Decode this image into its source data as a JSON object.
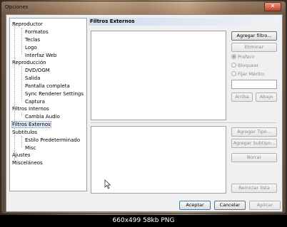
{
  "window": {
    "title": "Opciones",
    "close_glyph": "✕"
  },
  "tree": [
    {
      "label": "Reproductor"
    },
    {
      "label": "Formatos"
    },
    {
      "label": "Teclas"
    },
    {
      "label": "Logo"
    },
    {
      "label": "Interfaz Web"
    },
    {
      "label": "Reproducción"
    },
    {
      "label": "DVD/OGM"
    },
    {
      "label": "Salida"
    },
    {
      "label": "Pantalla completa"
    },
    {
      "label": "Sync Renderer Settings"
    },
    {
      "label": "Captura"
    },
    {
      "label": "Filtros Internos"
    },
    {
      "label": "Cambia Audio"
    },
    {
      "label": "Filtros Externos",
      "selected": true
    },
    {
      "label": "Subtitulos"
    },
    {
      "label": "Estilo Predeterminado"
    },
    {
      "label": "Misc"
    },
    {
      "label": "Ajustes"
    },
    {
      "label": "Misceláneos"
    }
  ],
  "panel": {
    "header": "Filtros Externos",
    "buttons": {
      "add_filter": "Agregar filtro...",
      "remove": "Eliminar",
      "up": "Arriba",
      "down": "Abajo",
      "add_type": "Agregar Tipo...",
      "add_subtype": "Agregar Subtipo...",
      "delete": "Borrar",
      "reset_list": "Reiniciar lista"
    },
    "radios": {
      "prefer": "Preferir",
      "block": "Bloquear",
      "merit": "Fijar Mérito:"
    }
  },
  "dialog_buttons": {
    "accept": "Aceptar",
    "cancel": "Cancelar",
    "apply": "Aplicar"
  },
  "footer_caption": "660x499 58kb PNG"
}
